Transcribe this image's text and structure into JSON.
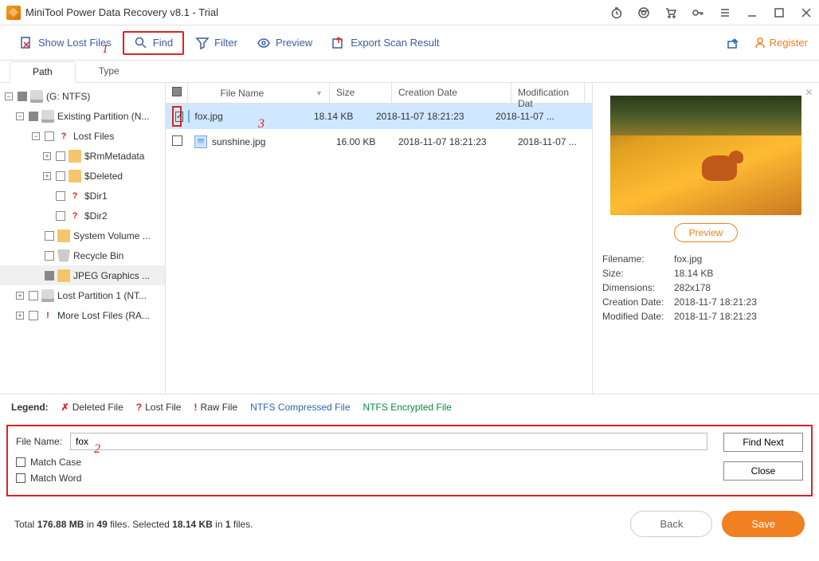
{
  "window": {
    "title": "MiniTool Power Data Recovery v8.1 - Trial"
  },
  "toolbar": {
    "show_lost": "Show Lost Files",
    "find": "Find",
    "filter": "Filter",
    "preview": "Preview",
    "export": "Export Scan Result",
    "register": "Register"
  },
  "tabs": {
    "path": "Path",
    "type": "Type"
  },
  "tree": {
    "root": "(G: NTFS)",
    "existing": "Existing Partition (N...",
    "lostfiles": "Lost Files",
    "rmmeta": "$RmMetadata",
    "deleted": "$Deleted",
    "dir1": "$Dir1",
    "dir2": "$Dir2",
    "sysvol": "System Volume ...",
    "recycle": "Recycle Bin",
    "jpeg": "JPEG Graphics ...",
    "lostpart": "Lost Partition 1 (NT...",
    "morelost": "More Lost Files (RA..."
  },
  "filehead": {
    "name": "File Name",
    "size": "Size",
    "cdate": "Creation Date",
    "mdate": "Modification Dat"
  },
  "files": [
    {
      "name": "fox.jpg",
      "size": "18.14 KB",
      "cdate": "2018-11-07 18:21:23",
      "mdate": "2018-11-07 ...",
      "checked": true
    },
    {
      "name": "sunshine.jpg",
      "size": "16.00 KB",
      "cdate": "2018-11-07 18:21:23",
      "mdate": "2018-11-07 ...",
      "checked": false
    }
  ],
  "preview": {
    "btn": "Preview",
    "k_filename": "Filename:",
    "v_filename": "fox.jpg",
    "k_size": "Size:",
    "v_size": "18.14 KB",
    "k_dim": "Dimensions:",
    "v_dim": "282x178",
    "k_cdate": "Creation Date:",
    "v_cdate": "2018-11-7 18:21:23",
    "k_mdate": "Modified Date:",
    "v_mdate": "2018-11-7 18:21:23"
  },
  "legend": {
    "label": "Legend:",
    "deleted": "Deleted File",
    "lost": "Lost File",
    "raw": "Raw File",
    "compressed": "NTFS Compressed File",
    "encrypted": "NTFS Encrypted File"
  },
  "find": {
    "filename_label": "File Name:",
    "filename_value": "fox",
    "match_case": "Match Case",
    "match_word": "Match Word",
    "find_next": "Find Next",
    "close": "Close"
  },
  "status": {
    "text_pre": "Total ",
    "total_size": "176.88 MB",
    "text_in": " in ",
    "total_files": "49",
    "text_files": " files.   Selected ",
    "sel_size": "18.14 KB",
    "text_in2": " in ",
    "sel_files": "1",
    "text_end": " files.",
    "back": "Back",
    "save": "Save"
  },
  "annotations": {
    "a1": "1",
    "a2": "2",
    "a3": "3"
  }
}
